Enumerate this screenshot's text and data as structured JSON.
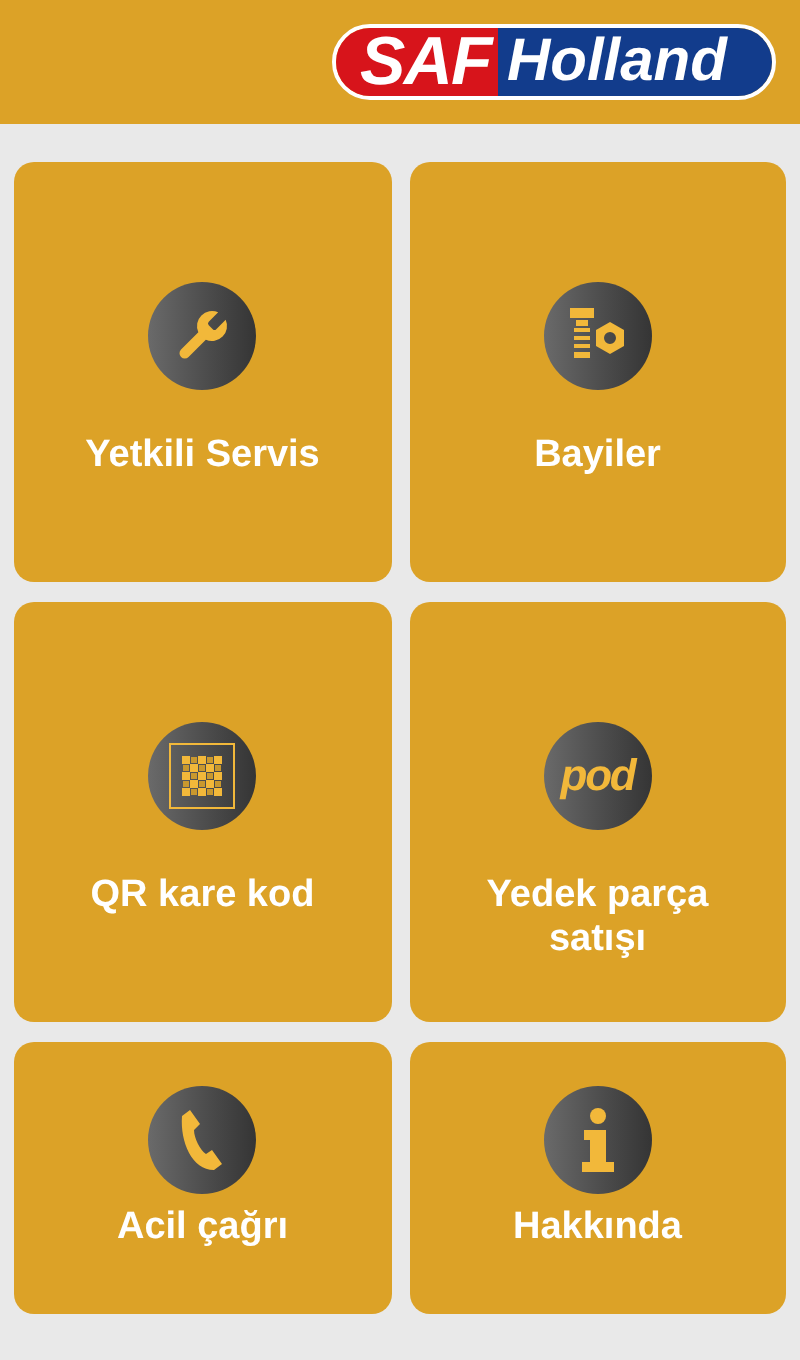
{
  "header": {
    "logo": {
      "left": "SAF",
      "right": "Holland"
    }
  },
  "pod_logo": "pod",
  "tiles": [
    {
      "label": "Yetkili Servis",
      "kind": "wrench"
    },
    {
      "label": "Bayiler",
      "kind": "bolt"
    },
    {
      "label": "QR kare kod",
      "kind": "qr"
    },
    {
      "label": "Yedek parça satışı",
      "kind": "pod"
    },
    {
      "label": "Acil çağrı",
      "kind": "phone"
    },
    {
      "label": "Hakkında",
      "kind": "info"
    }
  ]
}
